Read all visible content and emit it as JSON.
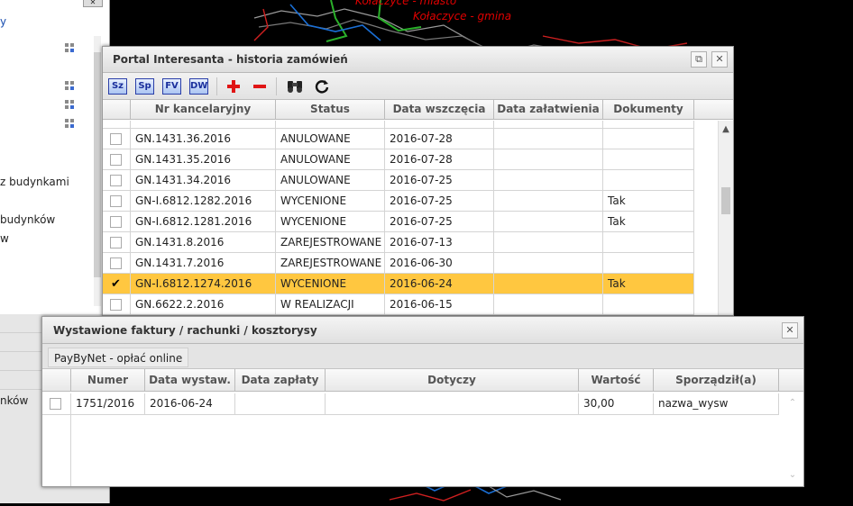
{
  "map": {
    "labels": [
      "Kołaczyce - miasto",
      "Kołaczyce - gmina"
    ],
    "label_color": "#e00000"
  },
  "left_panel": {
    "texts": [
      "z budynkami",
      "budynków",
      "w",
      "nków"
    ]
  },
  "history_window": {
    "title": "Portal Interesanta - historia zamówień",
    "toolbar": {
      "sz": "Sz",
      "sp": "Sp",
      "fv": "FV",
      "dw": "DW"
    },
    "columns": [
      "Nr kancelaryjny",
      "Status",
      "Data wszczęcia",
      "Data załatwienia",
      "Dokumenty"
    ],
    "rows": [
      {
        "nr": "GN.1431.36.2016",
        "status": "ANULOWANE",
        "data": "2016-07-28",
        "zal": "",
        "dok": "",
        "checked": ""
      },
      {
        "nr": "GN.1431.35.2016",
        "status": "ANULOWANE",
        "data": "2016-07-28",
        "zal": "",
        "dok": "",
        "checked": ""
      },
      {
        "nr": "GN.1431.34.2016",
        "status": "ANULOWANE",
        "data": "2016-07-25",
        "zal": "",
        "dok": "",
        "checked": ""
      },
      {
        "nr": "GN-I.6812.1282.2016",
        "status": "WYCENIONE",
        "data": "2016-07-25",
        "zal": "",
        "dok": "Tak",
        "checked": ""
      },
      {
        "nr": "GN-I.6812.1281.2016",
        "status": "WYCENIONE",
        "data": "2016-07-25",
        "zal": "",
        "dok": "Tak",
        "checked": ""
      },
      {
        "nr": "GN.1431.8.2016",
        "status": "ZAREJESTROWANE",
        "data": "2016-07-13",
        "zal": "",
        "dok": "",
        "checked": ""
      },
      {
        "nr": "GN.1431.7.2016",
        "status": "ZAREJESTROWANE",
        "data": "2016-06-30",
        "zal": "",
        "dok": "",
        "checked": ""
      },
      {
        "nr": "GN-I.6812.1274.2016",
        "status": "WYCENIONE",
        "data": "2016-06-24",
        "zal": "",
        "dok": "Tak",
        "checked": "✔"
      },
      {
        "nr": "GN.6622.2.2016",
        "status": "W REALIZACJI",
        "data": "2016-06-15",
        "zal": "",
        "dok": "",
        "checked": ""
      }
    ],
    "selected_color": "#ffc740"
  },
  "invoices_window": {
    "title": "Wystawione faktury / rachunki / kosztorysy",
    "paybynet_label": "PayByNet - opłać online",
    "columns": [
      "Numer",
      "Data wystaw.",
      "Data zapłaty",
      "Dotyczy",
      "Wartość",
      "Sporządził(a)"
    ],
    "rows": [
      {
        "numer": "1751/2016",
        "data_wyst": "2016-06-24",
        "data_zapl": "",
        "dotyczy": "",
        "wartosc": "30,00",
        "sporzadzil": "nazwa_wysw"
      }
    ]
  }
}
